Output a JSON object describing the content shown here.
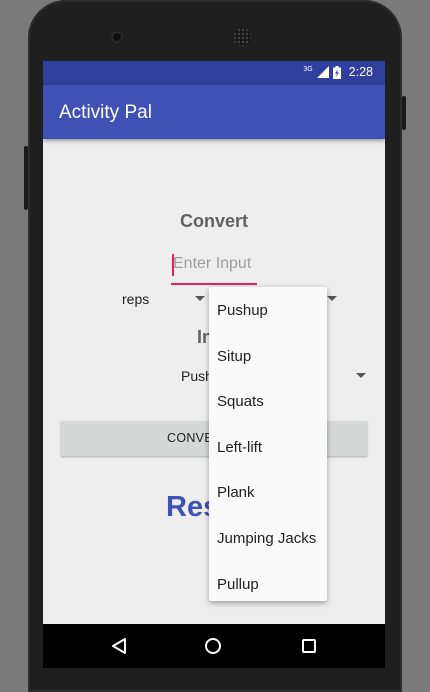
{
  "status_bar": {
    "network": "3G",
    "time": "2:28"
  },
  "app_bar": {
    "title": "Activity Pal"
  },
  "form": {
    "convert_label": "Convert",
    "input_placeholder": "Enter Input",
    "from_unit_value": "reps",
    "into_label_visible": "In",
    "to_activity_value": "Push",
    "convert_button_visible": "CONVE",
    "result_visible": "Res"
  },
  "dropdown": {
    "items": [
      "Pushup",
      "Situp",
      "Squats",
      "Left-lift",
      "Plank",
      "Jumping Jacks",
      "Pullup"
    ]
  },
  "colors": {
    "primary": "#3f51b5",
    "primary_dark": "#2f3f9e",
    "accent": "#e91e63"
  },
  "icons": {
    "nav": [
      "back-icon",
      "home-icon",
      "recents-icon"
    ],
    "status": [
      "signal-icon",
      "battery-icon"
    ]
  }
}
